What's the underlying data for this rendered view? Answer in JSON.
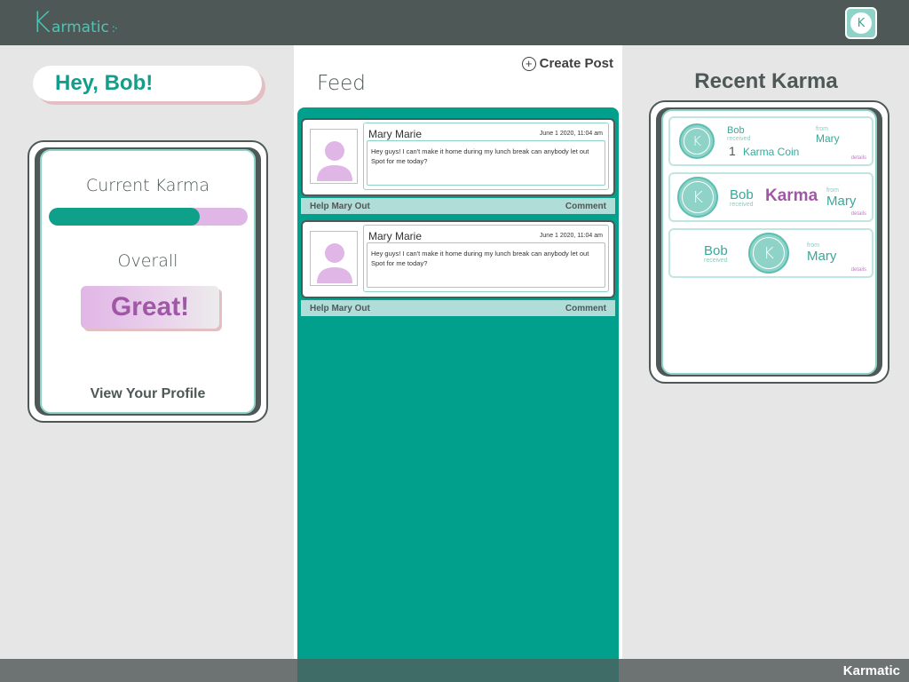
{
  "app": {
    "logo_k": "K",
    "logo_rest": "armatic",
    "logo_dots": ":·",
    "avatar_letter": "K"
  },
  "greeting": "Hey, Bob!",
  "karma_card": {
    "title": "Current Karma",
    "progress": 0.76,
    "overall_label": "Overall",
    "overall_value": "Great!",
    "view_profile": "View Your Profile"
  },
  "feed": {
    "create_post_label": "Create Post",
    "title": "Feed",
    "posts": [
      {
        "author": "Mary Marie",
        "date": "June 1 2020, 11:04 am",
        "text": "Hey guys! I can't make it home during my lunch break can anybody let out Spot for me today?",
        "help_label": "Help Mary Out",
        "comment_label": "Comment"
      },
      {
        "author": "Mary Marie",
        "date": "June 1 2020, 11:04 am",
        "text": "Hey guys! I can't make it home during my lunch break can anybody let out Spot for me today?",
        "help_label": "Help Mary Out",
        "comment_label": "Comment"
      }
    ]
  },
  "recent_karma": {
    "title": "Recent Karma",
    "items": [
      {
        "recipient": "Bob",
        "received_label": "received",
        "count": "1",
        "gift": "Karma Coin",
        "from_label": "from",
        "sender": "Mary",
        "details": "details"
      },
      {
        "recipient": "Bob",
        "received_label": "received",
        "gift": "Karma",
        "from_label": "from",
        "sender": "Mary",
        "details": "details"
      },
      {
        "recipient": "Bob",
        "received_label": "received",
        "from_label": "from",
        "sender": "Mary",
        "details": "details"
      }
    ]
  },
  "footer": {
    "brand": "Karmatic"
  },
  "colors": {
    "teal": "#00a08c",
    "dark_slate": "#4d5857",
    "pink": "#e0b6e6",
    "purple": "#a058a6"
  }
}
